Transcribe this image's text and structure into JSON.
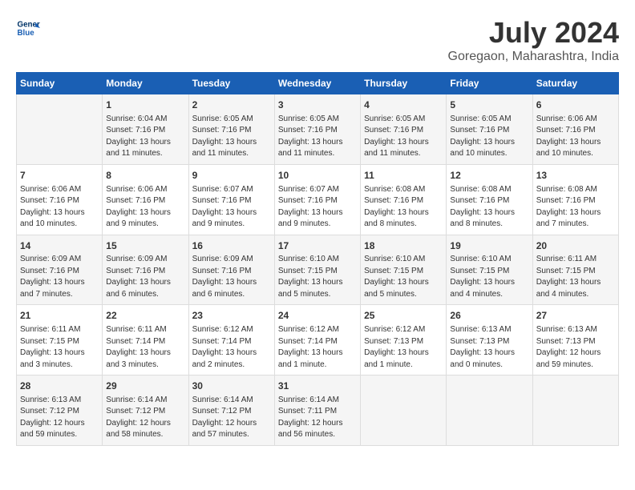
{
  "header": {
    "logo_line1": "General",
    "logo_line2": "Blue",
    "title": "July 2024",
    "subtitle": "Goregaon, Maharashtra, India"
  },
  "columns": [
    "Sunday",
    "Monday",
    "Tuesday",
    "Wednesday",
    "Thursday",
    "Friday",
    "Saturday"
  ],
  "weeks": [
    {
      "cells": [
        {
          "day": "",
          "info": ""
        },
        {
          "day": "1",
          "info": "Sunrise: 6:04 AM\nSunset: 7:16 PM\nDaylight: 13 hours\nand 11 minutes."
        },
        {
          "day": "2",
          "info": "Sunrise: 6:05 AM\nSunset: 7:16 PM\nDaylight: 13 hours\nand 11 minutes."
        },
        {
          "day": "3",
          "info": "Sunrise: 6:05 AM\nSunset: 7:16 PM\nDaylight: 13 hours\nand 11 minutes."
        },
        {
          "day": "4",
          "info": "Sunrise: 6:05 AM\nSunset: 7:16 PM\nDaylight: 13 hours\nand 11 minutes."
        },
        {
          "day": "5",
          "info": "Sunrise: 6:05 AM\nSunset: 7:16 PM\nDaylight: 13 hours\nand 10 minutes."
        },
        {
          "day": "6",
          "info": "Sunrise: 6:06 AM\nSunset: 7:16 PM\nDaylight: 13 hours\nand 10 minutes."
        }
      ]
    },
    {
      "cells": [
        {
          "day": "7",
          "info": "Sunrise: 6:06 AM\nSunset: 7:16 PM\nDaylight: 13 hours\nand 10 minutes."
        },
        {
          "day": "8",
          "info": "Sunrise: 6:06 AM\nSunset: 7:16 PM\nDaylight: 13 hours\nand 9 minutes."
        },
        {
          "day": "9",
          "info": "Sunrise: 6:07 AM\nSunset: 7:16 PM\nDaylight: 13 hours\nand 9 minutes."
        },
        {
          "day": "10",
          "info": "Sunrise: 6:07 AM\nSunset: 7:16 PM\nDaylight: 13 hours\nand 9 minutes."
        },
        {
          "day": "11",
          "info": "Sunrise: 6:08 AM\nSunset: 7:16 PM\nDaylight: 13 hours\nand 8 minutes."
        },
        {
          "day": "12",
          "info": "Sunrise: 6:08 AM\nSunset: 7:16 PM\nDaylight: 13 hours\nand 8 minutes."
        },
        {
          "day": "13",
          "info": "Sunrise: 6:08 AM\nSunset: 7:16 PM\nDaylight: 13 hours\nand 7 minutes."
        }
      ]
    },
    {
      "cells": [
        {
          "day": "14",
          "info": "Sunrise: 6:09 AM\nSunset: 7:16 PM\nDaylight: 13 hours\nand 7 minutes."
        },
        {
          "day": "15",
          "info": "Sunrise: 6:09 AM\nSunset: 7:16 PM\nDaylight: 13 hours\nand 6 minutes."
        },
        {
          "day": "16",
          "info": "Sunrise: 6:09 AM\nSunset: 7:16 PM\nDaylight: 13 hours\nand 6 minutes."
        },
        {
          "day": "17",
          "info": "Sunrise: 6:10 AM\nSunset: 7:15 PM\nDaylight: 13 hours\nand 5 minutes."
        },
        {
          "day": "18",
          "info": "Sunrise: 6:10 AM\nSunset: 7:15 PM\nDaylight: 13 hours\nand 5 minutes."
        },
        {
          "day": "19",
          "info": "Sunrise: 6:10 AM\nSunset: 7:15 PM\nDaylight: 13 hours\nand 4 minutes."
        },
        {
          "day": "20",
          "info": "Sunrise: 6:11 AM\nSunset: 7:15 PM\nDaylight: 13 hours\nand 4 minutes."
        }
      ]
    },
    {
      "cells": [
        {
          "day": "21",
          "info": "Sunrise: 6:11 AM\nSunset: 7:15 PM\nDaylight: 13 hours\nand 3 minutes."
        },
        {
          "day": "22",
          "info": "Sunrise: 6:11 AM\nSunset: 7:14 PM\nDaylight: 13 hours\nand 3 minutes."
        },
        {
          "day": "23",
          "info": "Sunrise: 6:12 AM\nSunset: 7:14 PM\nDaylight: 13 hours\nand 2 minutes."
        },
        {
          "day": "24",
          "info": "Sunrise: 6:12 AM\nSunset: 7:14 PM\nDaylight: 13 hours\nand 1 minute."
        },
        {
          "day": "25",
          "info": "Sunrise: 6:12 AM\nSunset: 7:13 PM\nDaylight: 13 hours\nand 1 minute."
        },
        {
          "day": "26",
          "info": "Sunrise: 6:13 AM\nSunset: 7:13 PM\nDaylight: 13 hours\nand 0 minutes."
        },
        {
          "day": "27",
          "info": "Sunrise: 6:13 AM\nSunset: 7:13 PM\nDaylight: 12 hours\nand 59 minutes."
        }
      ]
    },
    {
      "cells": [
        {
          "day": "28",
          "info": "Sunrise: 6:13 AM\nSunset: 7:12 PM\nDaylight: 12 hours\nand 59 minutes."
        },
        {
          "day": "29",
          "info": "Sunrise: 6:14 AM\nSunset: 7:12 PM\nDaylight: 12 hours\nand 58 minutes."
        },
        {
          "day": "30",
          "info": "Sunrise: 6:14 AM\nSunset: 7:12 PM\nDaylight: 12 hours\nand 57 minutes."
        },
        {
          "day": "31",
          "info": "Sunrise: 6:14 AM\nSunset: 7:11 PM\nDaylight: 12 hours\nand 56 minutes."
        },
        {
          "day": "",
          "info": ""
        },
        {
          "day": "",
          "info": ""
        },
        {
          "day": "",
          "info": ""
        }
      ]
    }
  ]
}
